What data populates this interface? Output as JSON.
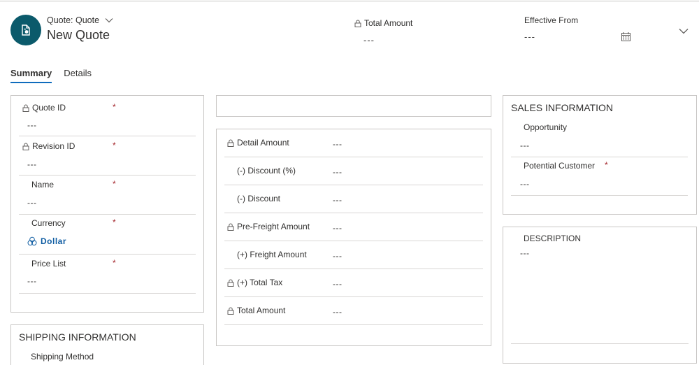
{
  "header": {
    "entity_type": "Quote: Quote",
    "record_name": "New Quote",
    "total_amount": {
      "label": "Total Amount",
      "value": "---"
    },
    "effective_from": {
      "label": "Effective From",
      "value": "---"
    }
  },
  "tabs": [
    {
      "label": "Summary",
      "active": true
    },
    {
      "label": "Details",
      "active": false
    }
  ],
  "general": {
    "fields": [
      {
        "label": "Quote ID",
        "value": "---",
        "locked": true,
        "required": "*"
      },
      {
        "label": "Revision ID",
        "value": "---",
        "locked": true,
        "required": "*"
      },
      {
        "label": "Name",
        "value": "---",
        "locked": false,
        "required": "*"
      },
      {
        "label": "Currency",
        "value": "Dollar",
        "locked": false,
        "required": "*"
      },
      {
        "label": "Price List",
        "value": "---",
        "locked": false,
        "required": "*"
      }
    ]
  },
  "shipping": {
    "title": "SHIPPING INFORMATION",
    "shipping_method_label": "Shipping Method"
  },
  "amounts": {
    "rows": [
      {
        "label": "Detail Amount",
        "value": "---"
      },
      {
        "label": "(-) Discount (%)",
        "value": "---"
      },
      {
        "label": "(-) Discount",
        "value": "---"
      },
      {
        "label": "Pre-Freight Amount",
        "value": "---"
      },
      {
        "label": "(+) Freight Amount",
        "value": "---"
      },
      {
        "label": "(+) Total Tax",
        "value": "---"
      },
      {
        "label": "Total Amount",
        "value": "---"
      }
    ]
  },
  "sales": {
    "title": "SALES INFORMATION",
    "opportunity": {
      "label": "Opportunity",
      "value": "---"
    },
    "potential_customer": {
      "label": "Potential Customer",
      "value": "---",
      "required": "*"
    }
  },
  "description": {
    "label": "DESCRIPTION",
    "value": "---"
  },
  "colors": {
    "avatar_bg": "#0b5a6b",
    "accent": "#0f6cbd",
    "link": "#115ea3",
    "required": "#a4262c",
    "border": "#c8c6c4"
  }
}
